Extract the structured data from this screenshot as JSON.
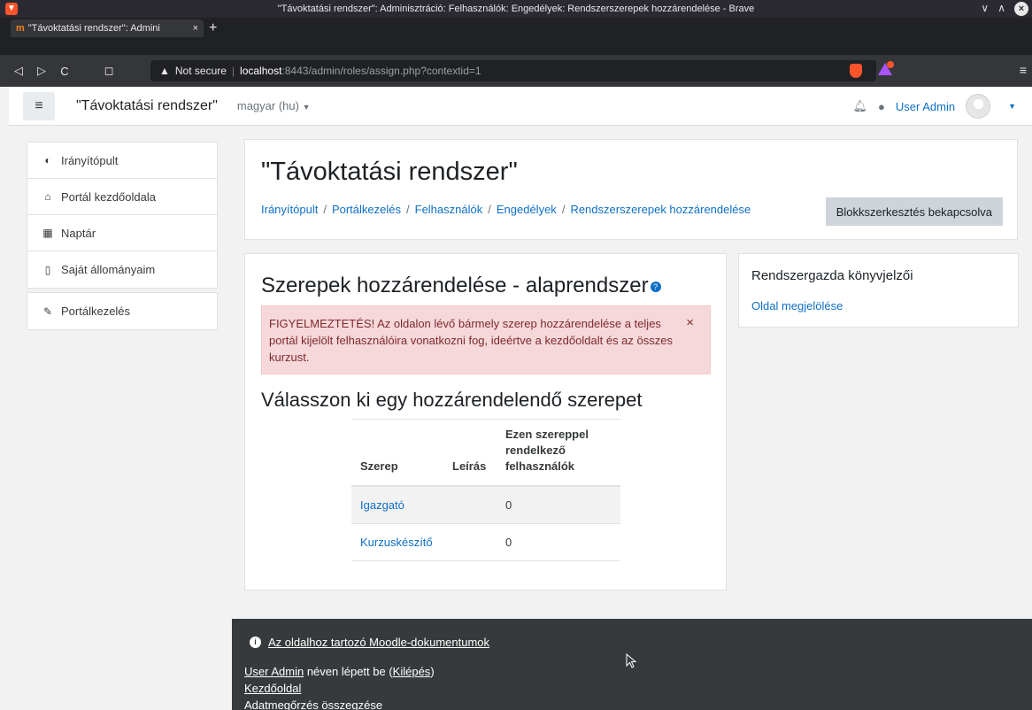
{
  "window": {
    "title": "\"Távoktatási rendszer\": Adminisztráció: Felhasználók: Engedélyek: Rendszerszerepek hozzárendelése - Brave"
  },
  "tab": {
    "title": "\"Távoktatási rendszer\": Admini",
    "close": "×",
    "new": "+"
  },
  "address": {
    "warning": "Not secure",
    "host": "localhost",
    "rest": ":8443/admin/roles/assign.php?contextid=1"
  },
  "moodle_nav": {
    "sitename": "\"Távoktatási rendszer\"",
    "language": "magyar (hu)",
    "user": "User Admin"
  },
  "drawer": {
    "group1": [
      {
        "label": "Irányítópult",
        "icon": "dashboard-icon"
      },
      {
        "label": "Portál kezdőoldala",
        "icon": "home-icon"
      },
      {
        "label": "Naptár",
        "icon": "calendar-icon"
      },
      {
        "label": "Saját állományaim",
        "icon": "file-icon"
      }
    ],
    "group2": [
      {
        "label": "Portálkezelés",
        "icon": "wrench-icon"
      }
    ]
  },
  "header": {
    "title": "\"Távoktatási rendszer\"",
    "breadcrumbs": [
      "Irányítópult",
      "Portálkezelés",
      "Felhasználók",
      "Engedélyek",
      "Rendszerszerepek hozzárendelése"
    ],
    "edit_button": "Blokkszerkesztés bekapcsolva"
  },
  "main": {
    "heading": "Szerepek hozzárendelése - alaprendszer",
    "alert": "FIGYELMEZTETÉS! Az oldalon lévő bármely szerep hozzárendelése a teljes portál kijelölt felhasználóira vonatkozni fog, ideértve a kezdőoldalt és az összes kurzust.",
    "alert_close": "×",
    "subheading": "Válasszon ki egy hozzárendelendő szerepet",
    "table": {
      "headers": [
        "Szerep",
        "Leírás",
        "Ezen szereppel rendelkező felhasználók"
      ],
      "rows": [
        {
          "role": "Igazgató",
          "description": "",
          "count": "0"
        },
        {
          "role": "Kurzuskészítő",
          "description": "",
          "count": "0"
        }
      ]
    }
  },
  "sideblock": {
    "title": "Rendszergazda könyvjelzői",
    "link": "Oldal megjelölése"
  },
  "footer": {
    "doc_link": "Az oldalhoz tartozó Moodle-dokumentumok",
    "user_link": "User Admin",
    "logged_in_text": " néven lépett be (",
    "logout": "Kilépés",
    "logged_in_end": ")",
    "home": "Kezdőoldal",
    "retention": "Adatmegőrzés összegzése"
  }
}
